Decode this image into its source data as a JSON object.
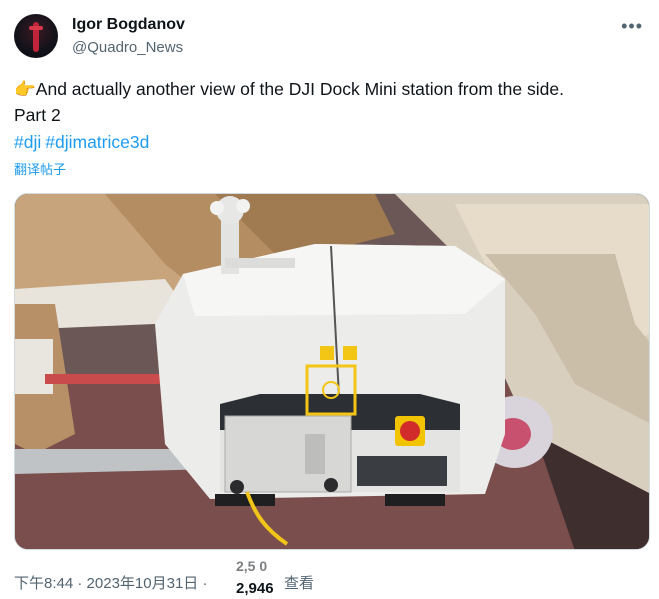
{
  "author": {
    "display_name": "Igor Bogdanov",
    "handle": "@Quadro_News",
    "more_icon": "ellipsis-icon"
  },
  "tweet": {
    "emoji": "👉",
    "text_line1": "And actually another view of the DJI Dock Mini station from the side.",
    "text_line2": "Part 2",
    "hashtags": [
      "#dji",
      "#djimatrice3d"
    ],
    "translate_label": "翻译帖子"
  },
  "media": {
    "alt": "photo-dji-dock-mini"
  },
  "meta": {
    "time": "下午8:44",
    "separator": "·",
    "date": "2023年10月31日",
    "views_old": "2,5 0",
    "views": "2,946",
    "views_label": "查看"
  }
}
